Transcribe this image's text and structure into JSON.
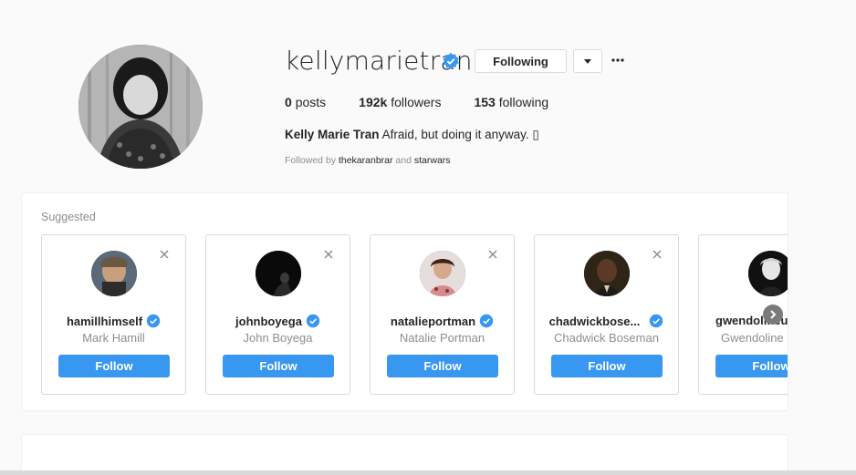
{
  "profile": {
    "username": "kellymarietran",
    "following_label": "Following",
    "stats": {
      "posts_count": "0",
      "posts_label": "posts",
      "followers_count": "192k",
      "followers_label": "followers",
      "following_count": "153",
      "following_label": "following"
    },
    "bio_name": "Kelly Marie Tran",
    "bio_text": "Afraid, but doing it anyway. ▯",
    "followed_by_prefix": "Followed by",
    "followed_by_user1": "thekaranbrar",
    "followed_by_and": "and",
    "followed_by_user2": "starwars"
  },
  "suggested": {
    "title": "Suggested",
    "cards": [
      {
        "username": "hamillhimself",
        "fullname": "Mark Hamill",
        "follow_label": "Follow"
      },
      {
        "username": "johnboyega",
        "fullname": "John Boyega",
        "follow_label": "Follow"
      },
      {
        "username": "natalieportman",
        "fullname": "Natalie Portman",
        "follow_label": "Follow"
      },
      {
        "username": "chadwickbose...",
        "fullname": "Chadwick Boseman",
        "follow_label": "Follow"
      },
      {
        "username": "gwendolineur",
        "fullname": "Gwendoline C",
        "follow_label": "Follow"
      }
    ]
  },
  "colors": {
    "accent": "#3897f0",
    "verified": "#3897f0",
    "muted_text": "#8e8e8e"
  },
  "icons": [
    "verified-badge-icon",
    "caret-down-icon",
    "more-options-icon",
    "close-icon",
    "chevron-right-icon"
  ]
}
